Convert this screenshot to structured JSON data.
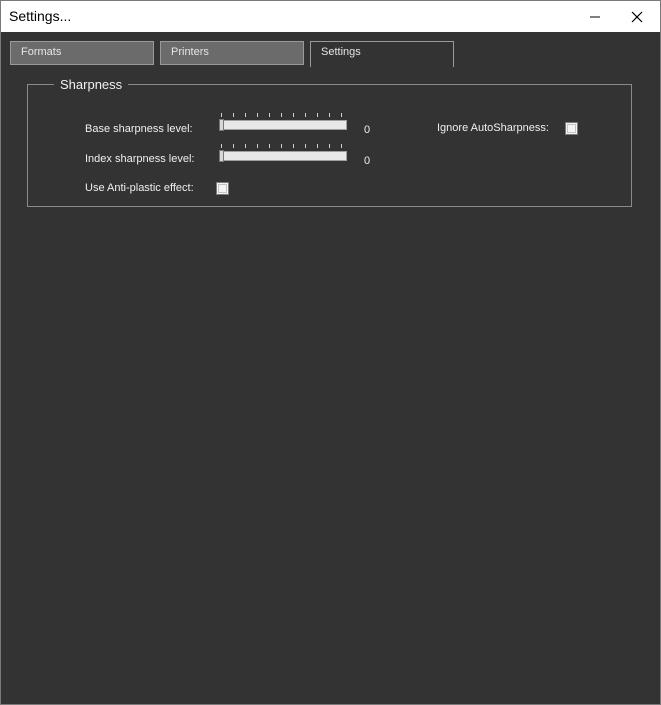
{
  "window": {
    "title": "Settings..."
  },
  "tabs": [
    {
      "label": "Formats",
      "active": false
    },
    {
      "label": "Printers",
      "active": false
    },
    {
      "label": "Settings",
      "active": true
    }
  ],
  "sharpness": {
    "group_title": "Sharpness",
    "base_label": "Base sharpness level:",
    "base_value": "0",
    "index_label": "Index sharpness level:",
    "index_value": "0",
    "anti_plastic_label": "Use Anti-plastic effect:",
    "anti_plastic_checked": false,
    "ignore_auto_label": "Ignore AutoSharpness:",
    "ignore_auto_checked": false
  },
  "icons": {
    "minimize": "minimize-icon",
    "close": "close-icon"
  },
  "colors": {
    "background": "#333333",
    "tab_inactive": "#6b6b6b",
    "titlebar": "#ffffff"
  }
}
